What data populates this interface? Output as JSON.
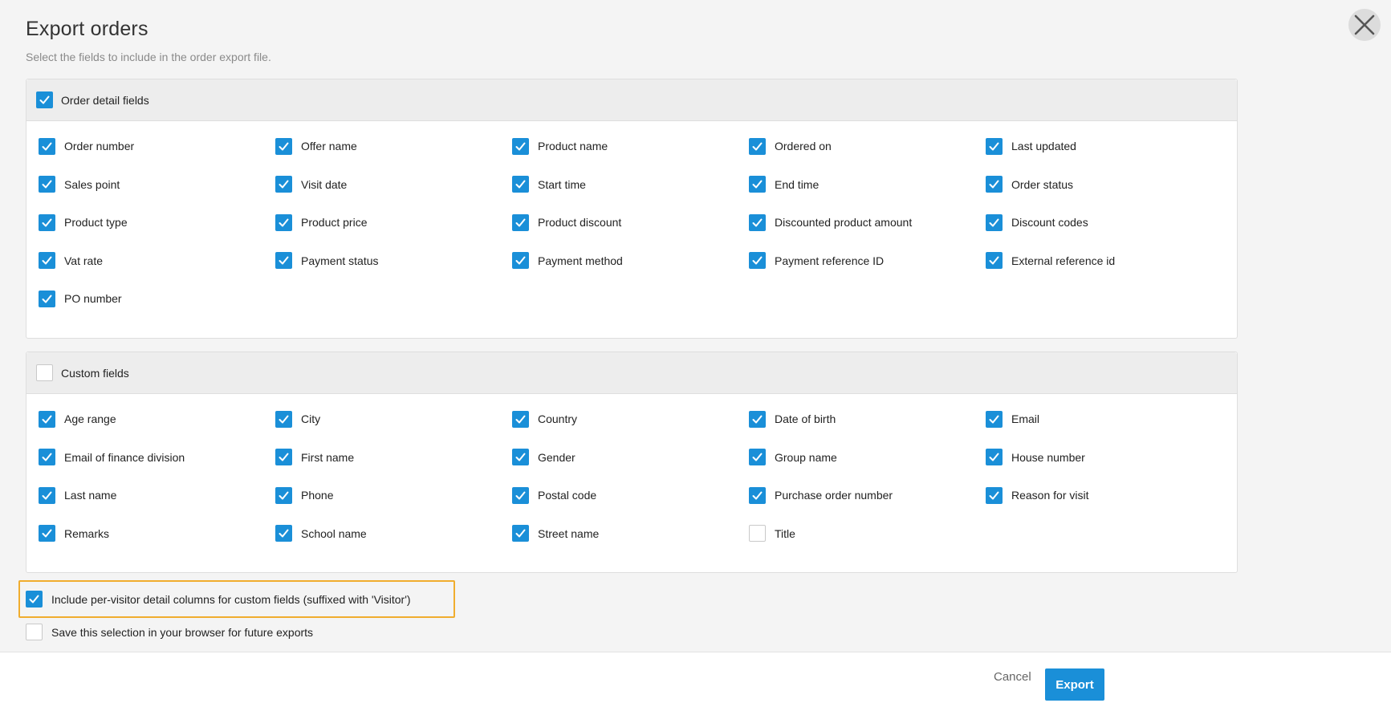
{
  "dialog": {
    "title": "Export orders",
    "subtitle": "Select the fields to include in the order export file.",
    "close_icon": "close-icon"
  },
  "sections": [
    {
      "header_label": "Order detail fields",
      "header_checked": true,
      "fields": [
        {
          "label": "Order number",
          "checked": true
        },
        {
          "label": "Offer name",
          "checked": true
        },
        {
          "label": "Product name",
          "checked": true
        },
        {
          "label": "Ordered on",
          "checked": true
        },
        {
          "label": "Last updated",
          "checked": true
        },
        {
          "label": "Sales point",
          "checked": true
        },
        {
          "label": "Visit date",
          "checked": true
        },
        {
          "label": "Start time",
          "checked": true
        },
        {
          "label": "End time",
          "checked": true
        },
        {
          "label": "Order status",
          "checked": true
        },
        {
          "label": "Product type",
          "checked": true
        },
        {
          "label": "Product price",
          "checked": true
        },
        {
          "label": "Product discount",
          "checked": true
        },
        {
          "label": "Discounted product amount",
          "checked": true
        },
        {
          "label": "Discount codes",
          "checked": true
        },
        {
          "label": "Vat rate",
          "checked": true
        },
        {
          "label": "Payment status",
          "checked": true
        },
        {
          "label": "Payment method",
          "checked": true
        },
        {
          "label": "Payment reference ID",
          "checked": true
        },
        {
          "label": "External reference id",
          "checked": true
        },
        {
          "label": "PO number",
          "checked": true
        }
      ]
    },
    {
      "header_label": "Custom fields",
      "header_checked": false,
      "fields": [
        {
          "label": "Age range",
          "checked": true
        },
        {
          "label": "City",
          "checked": true
        },
        {
          "label": "Country",
          "checked": true
        },
        {
          "label": "Date of birth",
          "checked": true
        },
        {
          "label": "Email",
          "checked": true
        },
        {
          "label": "Email of finance division",
          "checked": true
        },
        {
          "label": "First name",
          "checked": true
        },
        {
          "label": "Gender",
          "checked": true
        },
        {
          "label": "Group name",
          "checked": true
        },
        {
          "label": "House number",
          "checked": true
        },
        {
          "label": "Last name",
          "checked": true
        },
        {
          "label": "Phone",
          "checked": true
        },
        {
          "label": "Postal code",
          "checked": true
        },
        {
          "label": "Purchase order number",
          "checked": true
        },
        {
          "label": "Reason for visit",
          "checked": true
        },
        {
          "label": "Remarks",
          "checked": true
        },
        {
          "label": "School name",
          "checked": true
        },
        {
          "label": "Street name",
          "checked": true
        },
        {
          "label": "Title",
          "checked": false
        }
      ]
    }
  ],
  "options": {
    "per_visitor": {
      "label": "Include per-visitor detail columns for custom fields (suffixed with 'Visitor')",
      "checked": true
    },
    "save_selection": {
      "label": "Save this selection in your browser for future exports",
      "checked": false
    }
  },
  "footer": {
    "cancel_label": "Cancel",
    "export_label": "Export"
  },
  "colors": {
    "accent": "#1a8fd8",
    "highlight_border": "#f0ad2e",
    "background": "#f4f4f4"
  }
}
